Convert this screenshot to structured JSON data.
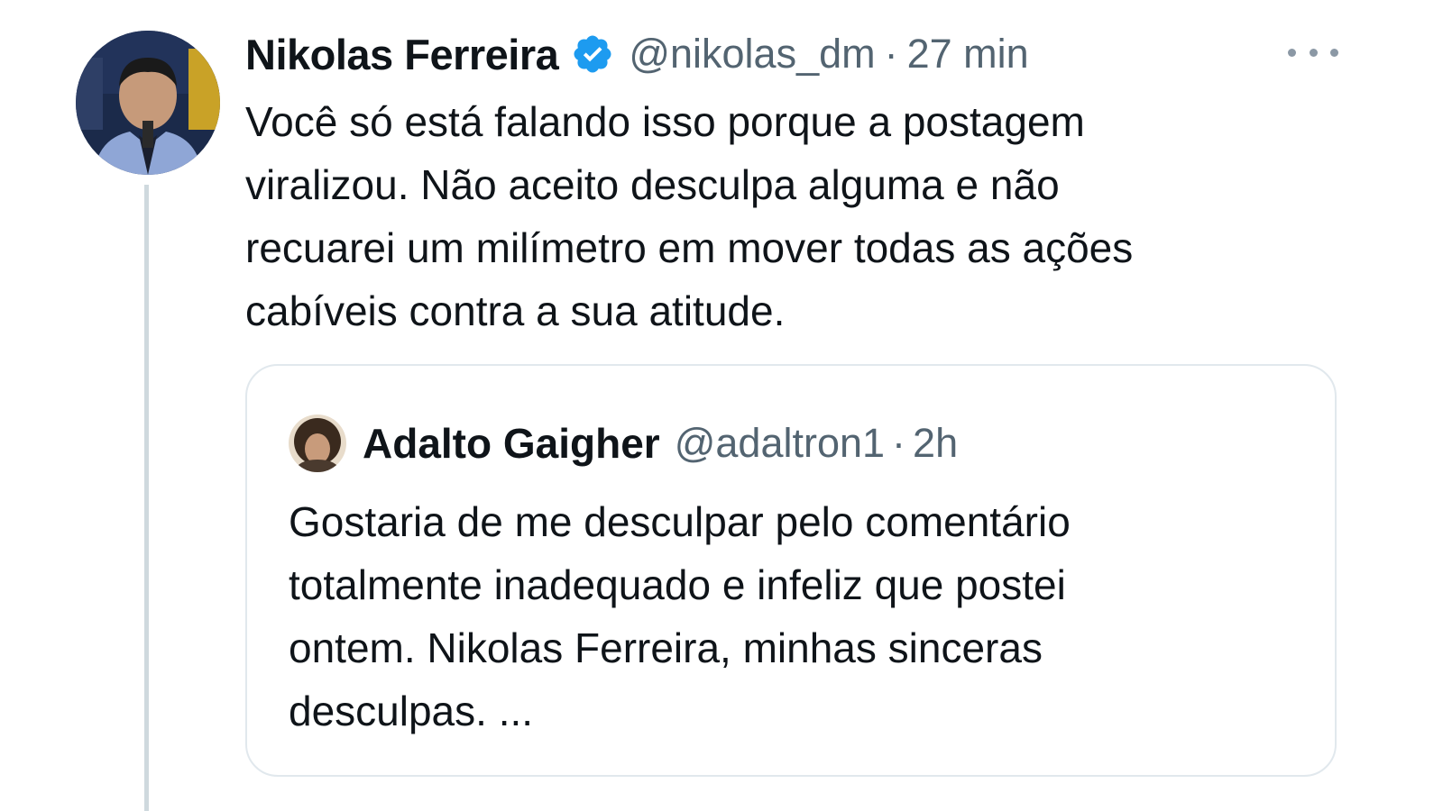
{
  "tweet": {
    "author_name": "Nikolas Ferreira",
    "author_handle": "@nikolas_dm",
    "separator": "·",
    "time": "27 min",
    "verified_icon": "verified-badge-icon",
    "more_icon": "more-dots-icon",
    "text_lines": [
      "Você só está falando isso porque a postagem",
      "viralizou. Não aceito desculpa alguma e não",
      "recuarei um milímetro em mover todas as ações",
      "cabíveis contra a sua atitude."
    ]
  },
  "quoted_tweet": {
    "author_name": "Adalto Gaigher",
    "author_handle": "@adaltron1",
    "separator": "·",
    "time": "2h",
    "text_lines": [
      "Gostaria de me desculpar pelo comentário",
      "totalmente inadequado e infeliz que postei",
      "ontem. Nikolas Ferreira, minhas sinceras",
      "desculpas. ..."
    ]
  },
  "colors": {
    "verified_blue": "#1d9bf0",
    "secondary_text": "#536471",
    "primary_text": "#0f1419",
    "border": "#e1e8ed",
    "thread_line": "#cfd9de"
  }
}
